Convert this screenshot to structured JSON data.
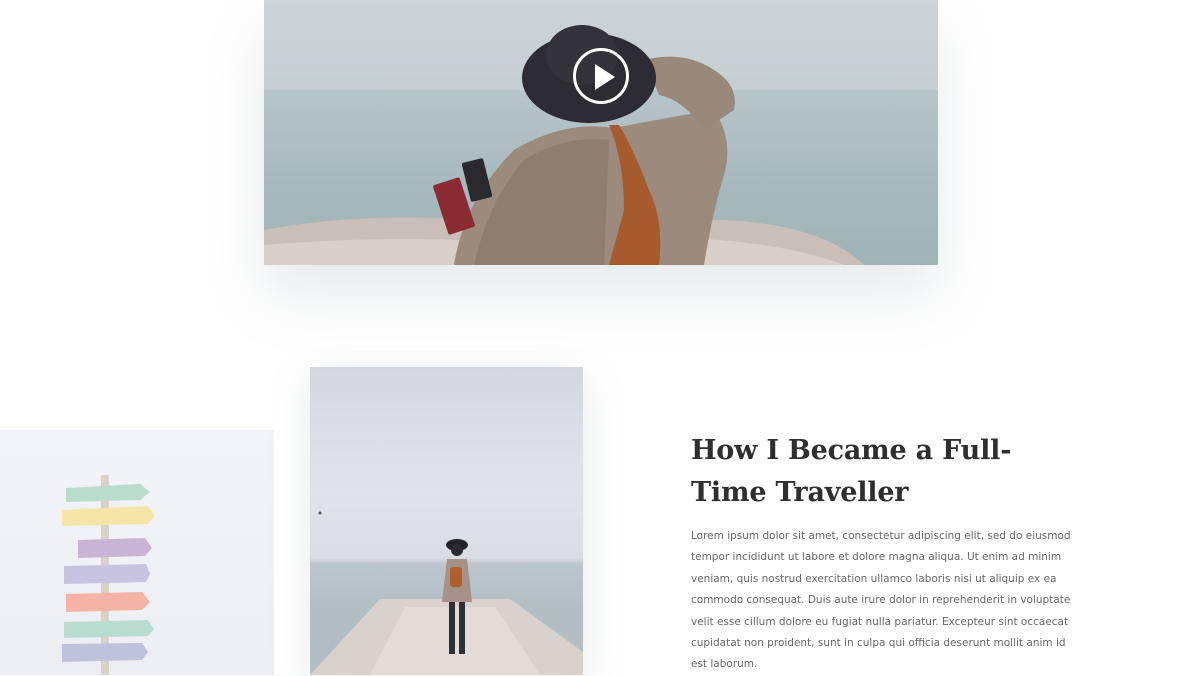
{
  "hero_video": {
    "play_icon": "play-icon"
  },
  "article": {
    "title": "How I Became a Full-Time Traveller",
    "body": "Lorem ipsum dolor sit amet, consectetur adipiscing elit, sed do eiusmod tempor incididunt ut labore et dolore magna aliqua. Ut enim ad minim veniam, quis nostrud exercitation ullamco laboris nisi ut aliquip ex ea commodo consequat. Duis aute irure dolor in reprehenderit in voluptate velit esse cillum dolore eu fugiat nulla pariatur. Excepteur sint occaecat cupidatat non proident, sunt in culpa qui officia deserunt mollit anim id est laborum."
  },
  "colors": {
    "title": "#2f2f2f",
    "body_text": "#666666",
    "background": "#ffffff"
  }
}
